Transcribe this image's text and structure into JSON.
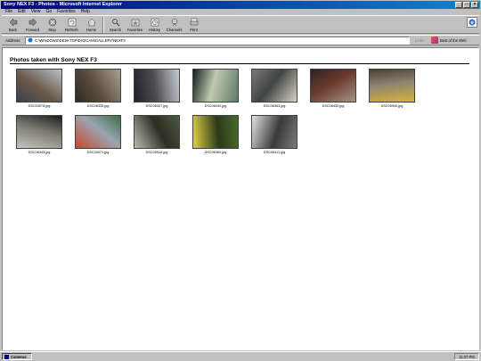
{
  "window": {
    "title": "Sony NEX F3 - Photos - Microsoft Internet Explorer",
    "buttons": [
      "_",
      "□",
      "×"
    ]
  },
  "menu": [
    "File",
    "Edit",
    "View",
    "Go",
    "Favorites",
    "Help"
  ],
  "toolbar": [
    {
      "label": "Back",
      "icon": "back-arrow-icon"
    },
    {
      "label": "Forward",
      "icon": "forward-arrow-icon"
    },
    {
      "label": "Stop",
      "icon": "stop-icon"
    },
    {
      "label": "Refresh",
      "icon": "refresh-icon"
    },
    {
      "label": "Home",
      "icon": "home-icon"
    },
    {
      "label": "Search",
      "icon": "search-icon"
    },
    {
      "label": "Favorites",
      "icon": "favorites-icon"
    },
    {
      "label": "History",
      "icon": "history-icon"
    },
    {
      "label": "Channels",
      "icon": "channels-icon"
    },
    {
      "label": "Print",
      "icon": "print-icon"
    }
  ],
  "address": {
    "label": "Address",
    "value": "C:\\WINDOWS\\DESKTOP\\DIGICAM\\GALLERY\\NEXF3",
    "links_label": "Links",
    "best_label": "Best of the Web"
  },
  "page": {
    "title": "Photos taken with Sony NEX F3",
    "photos": [
      {
        "caption": "DSC04076.jpg",
        "colors": [
          "#3b4250",
          "#b7c0c9",
          "#6a5a4a"
        ]
      },
      {
        "caption": "DSC06335.jpg",
        "colors": [
          "#2e2a26",
          "#a89f8f",
          "#5b4c3c"
        ]
      },
      {
        "caption": "DSC06407.jpg",
        "colors": [
          "#1f2226",
          "#c7ccd1",
          "#4a4c50"
        ]
      },
      {
        "caption": "DSC06040.jpg",
        "colors": [
          "#12231c",
          "#5d7b6a",
          "#c0c8b0"
        ]
      },
      {
        "caption": "DSC06363.jpg",
        "colors": [
          "#7b7a75",
          "#d9d2c2",
          "#3f4542"
        ]
      },
      {
        "caption": "DSC06430.jpg",
        "colors": [
          "#2e2222",
          "#a29488",
          "#6a3a2c"
        ]
      },
      {
        "caption": "DSC05940.jpg",
        "colors": [
          "#4a4030",
          "#d3b23a",
          "#8f8474"
        ]
      },
      {
        "caption": "DSC06343.jpg",
        "colors": [
          "#1c1c1c",
          "#c6c6c0",
          "#7a7a70"
        ]
      },
      {
        "caption": "DSC04071.jpg",
        "colors": [
          "#3c6b4a",
          "#c44a2e",
          "#9aa6b0"
        ]
      },
      {
        "caption": "DSC05944.jpg",
        "colors": [
          "#4e5a3e",
          "#bdbab0",
          "#2a2e24"
        ]
      },
      {
        "caption": "DSC06360.jpg",
        "colors": [
          "#4a6a2a",
          "#e0d04a",
          "#2a3a18"
        ]
      },
      {
        "caption": "DSC06411.jpg",
        "colors": [
          "#7a7a7a",
          "#e2e2e0",
          "#3a3a38"
        ]
      }
    ]
  },
  "taskbar": {
    "task_label": "Cameras",
    "clock": "11:07 PM"
  }
}
